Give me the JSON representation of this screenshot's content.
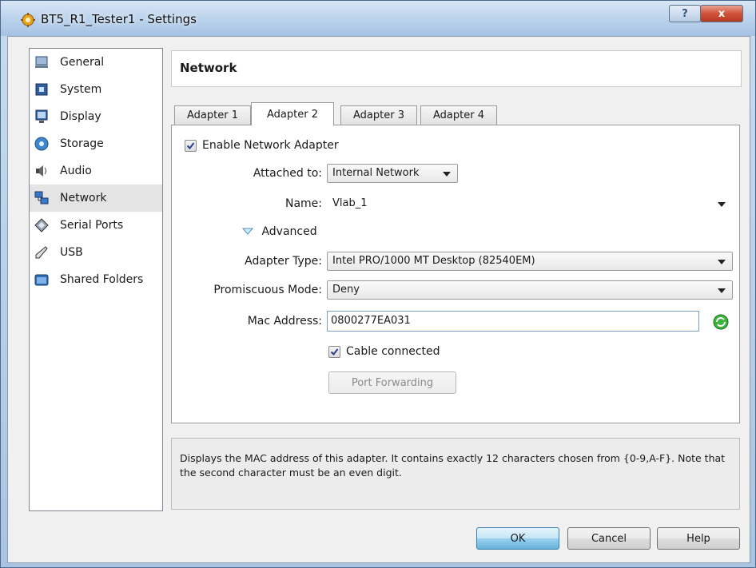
{
  "window": {
    "title": "BT5_R1_Tester1 - Settings",
    "help_button": "?",
    "close_button": "x"
  },
  "sidebar": {
    "items": [
      {
        "label": "General",
        "icon": "monitor-icon"
      },
      {
        "label": "System",
        "icon": "chip-icon"
      },
      {
        "label": "Display",
        "icon": "display-icon"
      },
      {
        "label": "Storage",
        "icon": "disk-icon"
      },
      {
        "label": "Audio",
        "icon": "speaker-icon"
      },
      {
        "label": "Network",
        "icon": "network-icon",
        "selected": true
      },
      {
        "label": "Serial Ports",
        "icon": "serial-port-icon"
      },
      {
        "label": "USB",
        "icon": "usb-icon"
      },
      {
        "label": "Shared Folders",
        "icon": "folder-icon"
      }
    ]
  },
  "section": {
    "title": "Network"
  },
  "tabs": [
    {
      "label": "Adapter 1"
    },
    {
      "label": "Adapter 2",
      "selected": true
    },
    {
      "label": "Adapter 3"
    },
    {
      "label": "Adapter 4"
    }
  ],
  "adapter": {
    "enable_label": "Enable Network Adapter",
    "enable_checked": true,
    "attached_to_label": "Attached to:",
    "attached_to_value": "Internal Network",
    "name_label": "Name:",
    "name_value": "Vlab_1",
    "advanced_label": "Advanced",
    "adapter_type_label": "Adapter Type:",
    "adapter_type_value": "Intel PRO/1000 MT Desktop (82540EM)",
    "promiscuous_label": "Promiscuous Mode:",
    "promiscuous_value": "Deny",
    "mac_label": "Mac Address:",
    "mac_value": "0800277EA031",
    "cable_label": "Cable connected",
    "cable_checked": true,
    "port_forwarding_label": "Port Forwarding"
  },
  "info": {
    "text": "Displays the MAC address of this adapter. It contains exactly 12 characters chosen from {0-9,A-F}. Note that the second character must be an even digit."
  },
  "footer": {
    "ok_label": "OK",
    "cancel_label": "Cancel",
    "help_label": "Help"
  },
  "colors": {
    "titlebar": "#bcd3ec",
    "close": "#d0523a",
    "default_button": "#98d1ef",
    "refresh_icon": "#2e9a2e"
  }
}
